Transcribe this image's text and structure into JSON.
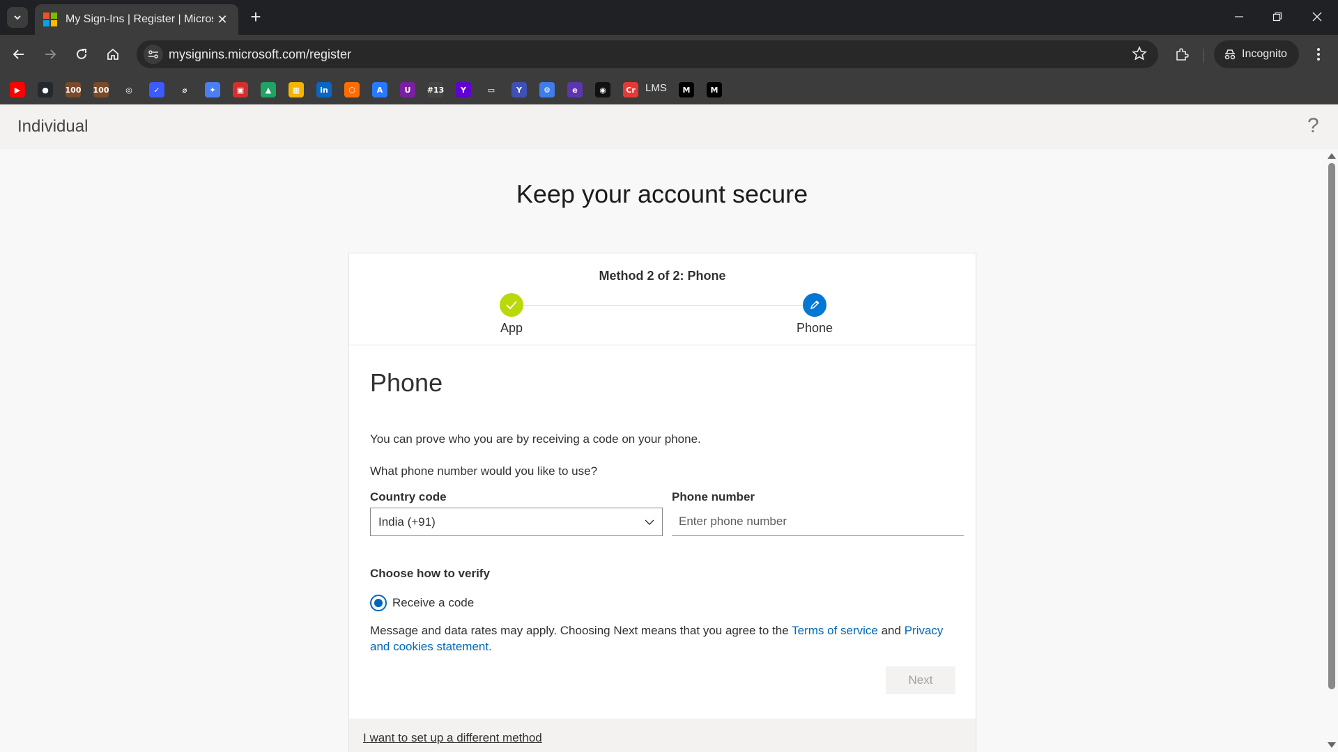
{
  "browser": {
    "tab_title": "My Sign-Ins | Register | Microsoft",
    "url": "mysignins.microsoft.com/register",
    "incognito_label": "Incognito",
    "bookmarks": [
      {
        "name": "youtube",
        "glyph": "▶",
        "color": "#ff0000"
      },
      {
        "name": "github",
        "glyph": "●",
        "color": "#24292f"
      },
      {
        "name": "gmail-100",
        "glyph": "100",
        "color": "#7a4a2a"
      },
      {
        "name": "gmail-100b",
        "glyph": "100",
        "color": "#7a4a2a"
      },
      {
        "name": "openai",
        "glyph": "◎",
        "color": "#3c3c3c"
      },
      {
        "name": "bookmark-6",
        "glyph": "✓",
        "color": "#3d5afe"
      },
      {
        "name": "bookmark-7",
        "glyph": "⌀",
        "color": "#3c3c3c"
      },
      {
        "name": "gemini",
        "glyph": "✦",
        "color": "#4c7ef3"
      },
      {
        "name": "bookmark-9",
        "glyph": "▣",
        "color": "#d32f2f"
      },
      {
        "name": "drive",
        "glyph": "▲",
        "color": "#1fa463"
      },
      {
        "name": "bookmark-11",
        "glyph": "▦",
        "color": "#f4b400"
      },
      {
        "name": "linkedin",
        "glyph": "in",
        "color": "#0a66c2"
      },
      {
        "name": "bookmark-13",
        "glyph": "⬡",
        "color": "#ff6d00"
      },
      {
        "name": "bookmark-14",
        "glyph": "A",
        "color": "#2979ff"
      },
      {
        "name": "bookmark-15",
        "glyph": "U",
        "color": "#7b1fa2"
      },
      {
        "name": "bookmark-16",
        "glyph": "#13",
        "color": "#444"
      },
      {
        "name": "yahoo",
        "glyph": "Y",
        "color": "#6001d2"
      },
      {
        "name": "folder",
        "glyph": "▭",
        "color": "#3c3c3c"
      },
      {
        "name": "bookmark-19",
        "glyph": "Y",
        "color": "#3f51b5"
      },
      {
        "name": "bookmark-20",
        "glyph": "⚙",
        "color": "#3f7de8"
      },
      {
        "name": "bookmark-21",
        "glyph": "e",
        "color": "#5e35b1"
      },
      {
        "name": "bookmark-22",
        "glyph": "◉",
        "color": "#111"
      },
      {
        "name": "bookmark-23",
        "glyph": "Cr",
        "color": "#e53935"
      },
      {
        "name": "medium",
        "glyph": "M",
        "color": "#000"
      },
      {
        "name": "medium-2",
        "glyph": "M",
        "color": "#000"
      }
    ],
    "lms_label": "LMS"
  },
  "header": {
    "brand": "Individual",
    "help_glyph": "?"
  },
  "main": {
    "title": "Keep your account secure",
    "method_title": "Method 2 of 2: Phone",
    "steps": [
      {
        "label": "App",
        "status": "complete",
        "color": "#bad80a"
      },
      {
        "label": "Phone",
        "status": "current",
        "color": "#0078d4"
      }
    ],
    "section_title": "Phone",
    "intro": "You can prove who you are by receiving a code on your phone.",
    "question": "What phone number would you like to use?",
    "country_code_label": "Country code",
    "country_code_value": "India (+91)",
    "phone_number_label": "Phone number",
    "phone_number_placeholder": "Enter phone number",
    "phone_number_value": "",
    "verify_label": "Choose how to verify",
    "verify_option": "Receive a code",
    "disclaimer_prefix": "Message and data rates may apply. Choosing Next means that you agree to the ",
    "terms_link": "Terms of service",
    "disclaimer_and": " and ",
    "privacy_link": "Privacy and cookies statement.",
    "next_label": "Next",
    "alt_method_link": "I want to set up a different method"
  },
  "colors": {
    "accent": "#0067b8",
    "complete": "#bad80a",
    "current": "#0078d4"
  }
}
